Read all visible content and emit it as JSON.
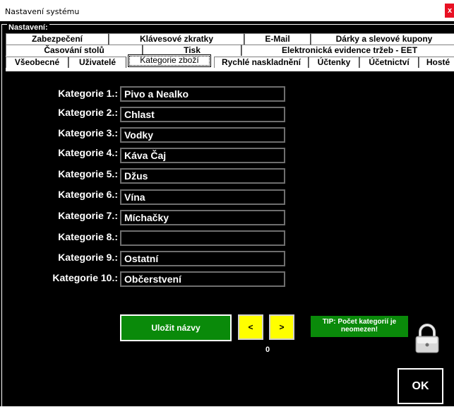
{
  "window": {
    "title": "Nastavení systému",
    "close_label": "x"
  },
  "frame_label": "Nastavení:",
  "tabs": {
    "row1": [
      "Zabezpečení",
      "Klávesové zkratky",
      "E-Mail",
      "Dárky a slevové kupony"
    ],
    "row2": [
      "Časování stolů",
      "Tisk",
      "Elektronická evidence tržeb - EET"
    ],
    "row3": [
      "Všeobecné",
      "Uživatelé",
      "Kategorie zboží",
      "Rychlé naskladnění",
      "Účtenky",
      "Účetnictví",
      "Hosté"
    ],
    "active": "Kategorie zboží"
  },
  "categories": [
    {
      "label": "Kategorie 1.:",
      "value": "Pivo a Nealko"
    },
    {
      "label": "Kategorie 2.:",
      "value": "Chlast"
    },
    {
      "label": "Kategorie 3.:",
      "value": "Vodky"
    },
    {
      "label": "Kategorie 4.:",
      "value": "Káva Čaj"
    },
    {
      "label": "Kategorie 5.:",
      "value": "Džus"
    },
    {
      "label": "Kategorie 6.:",
      "value": "Vína"
    },
    {
      "label": "Kategorie 7.:",
      "value": "Míchačky"
    },
    {
      "label": "Kategorie 8.:",
      "value": ""
    },
    {
      "label": "Kategorie 9.:",
      "value": "Ostatní"
    },
    {
      "label": "Kategorie 10.:",
      "value": "Občerstvení"
    }
  ],
  "actions": {
    "save_label": "Uložit názvy",
    "prev_label": "<",
    "next_label": ">",
    "counter": "0",
    "tip": "TIP: Počet kategorií je neomezen!",
    "ok_label": "OK",
    "lock_icon": "padlock-icon"
  },
  "colors": {
    "background": "#000000",
    "save_button": "#0a8a0a",
    "arrow_buttons": "#ffff00",
    "tip_box": "#0a8a0a"
  }
}
